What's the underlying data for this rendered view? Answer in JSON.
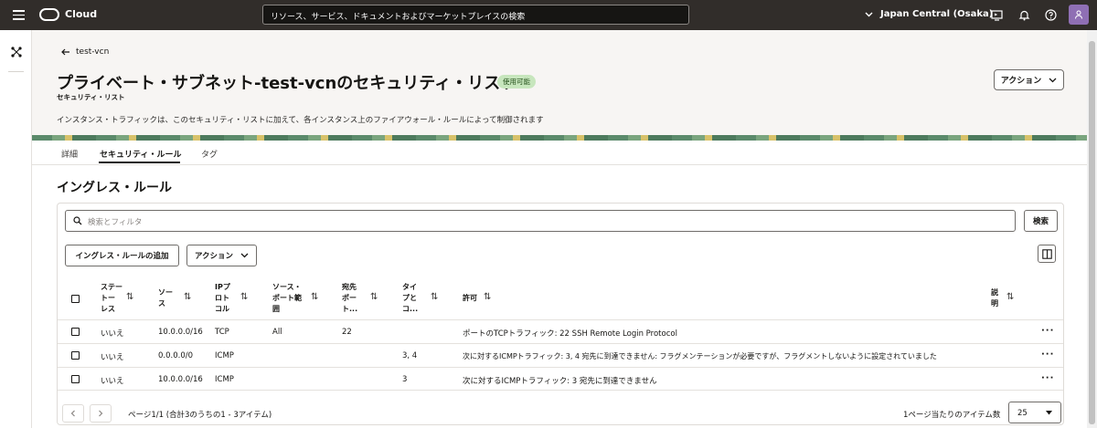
{
  "topbar": {
    "brand": "Cloud",
    "search_placeholder": "リソース、サービス、ドキュメントおよびマーケットプレイスの検索",
    "region": "Japan Central (Osaka)"
  },
  "header": {
    "back_label": "test-vcn",
    "title": "プライベート・サブネット-test-vcnのセキュリティ・リスト",
    "status": "使用可能",
    "subtitle": "セキュリティ・リスト",
    "description": "インスタンス・トラフィックは、このセキュリティ・リストに加えて、各インスタンス上のファイアウォール・ルールによって制御されます",
    "action_label": "アクション"
  },
  "tabs": [
    {
      "label": "詳細"
    },
    {
      "label": "セキュリティ・ルール"
    },
    {
      "label": "タグ"
    }
  ],
  "section": {
    "title": "イングレス・ルール",
    "search_placeholder": "検索とフィルタ",
    "search_button": "検索",
    "add_button": "イングレス・ルールの追加",
    "action_button": "アクション"
  },
  "table": {
    "headers": {
      "stateless": "ステー\nトー\nレス",
      "source": "ソー\nス",
      "ip_protocol": "IPプ\nロト\nコル",
      "source_port": "ソース・\nポート範\n囲",
      "dest_port": "宛先\nポー\nト...",
      "type_code": "タイ\nプと\nコ...",
      "allows": "許可",
      "description": "説\n明"
    },
    "rows": [
      {
        "stateless": "いいえ",
        "source": "10.0.0.0/16",
        "protocol": "TCP",
        "source_port": "All",
        "dest_port": "22",
        "type_code": "",
        "allows": "ポートのTCPトラフィック: 22 SSH Remote Login Protocol"
      },
      {
        "stateless": "いいえ",
        "source": "0.0.0.0/0",
        "protocol": "ICMP",
        "source_port": "",
        "dest_port": "",
        "type_code": "3, 4",
        "allows": "次に対するICMPトラフィック: 3, 4 宛先に到達できません: フラグメンテーションが必要ですが、フラグメントしないように設定されていました"
      },
      {
        "stateless": "いいえ",
        "source": "10.0.0.0/16",
        "protocol": "ICMP",
        "source_port": "",
        "dest_port": "",
        "type_code": "3",
        "allows": "次に対するICMPトラフィック: 3 宛先に到達できません"
      }
    ]
  },
  "footer": {
    "page_info": "ページ1/1 (合計3のうちの1 - 3アイテム)",
    "per_page_label": "1ページ当たりのアイテム数",
    "per_page_value": "25"
  }
}
